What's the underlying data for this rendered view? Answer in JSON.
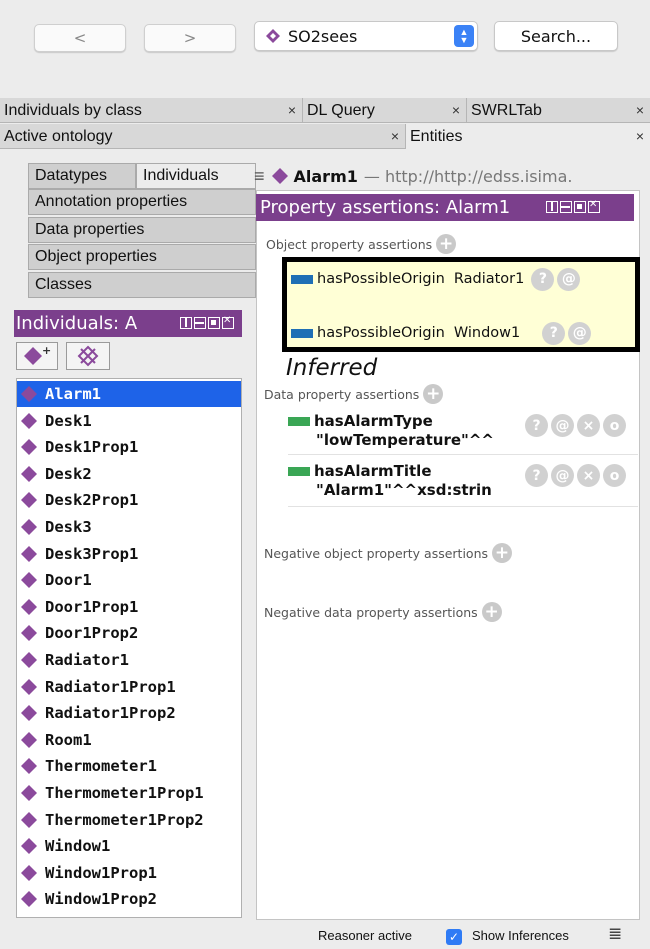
{
  "toolbar": {
    "back_label": "<",
    "forward_label": ">",
    "ontology_selector": "SO2sees",
    "search_label": "Search..."
  },
  "tabs_row1": [
    {
      "label": "Individuals by class",
      "close": "×"
    },
    {
      "label": "DL Query",
      "close": "×"
    },
    {
      "label": "SWRLTab",
      "close": "×"
    }
  ],
  "tabs_row2": [
    {
      "label": "Active ontology",
      "close": "×"
    },
    {
      "label": "Entities",
      "close": "×"
    }
  ],
  "left_tabs": {
    "datatypes": "Datatypes",
    "individuals": "Individuals",
    "annotation_properties": "Annotation properties",
    "data_properties": "Data properties",
    "object_properties": "Object properties",
    "classes": "Classes"
  },
  "individuals_panel": {
    "title": "Individuals: A",
    "items": [
      "Alarm1",
      "Desk1",
      "Desk1Prop1",
      "Desk2",
      "Desk2Prop1",
      "Desk3",
      "Desk3Prop1",
      "Door1",
      "Door1Prop1",
      "Door1Prop2",
      "Radiator1",
      "Radiator1Prop1",
      "Radiator1Prop2",
      "Room1",
      "Thermometer1",
      "Thermometer1Prop1",
      "Thermometer1Prop2",
      "Window1",
      "Window1Prop1",
      "Window1Prop2"
    ],
    "selected": "Alarm1"
  },
  "entity_header": {
    "name": "Alarm1",
    "iri": "— http://http://edss.isima."
  },
  "property_assertions": {
    "title": "Property assertions: Alarm1",
    "object_section": "Object property assertions",
    "object_assertions": [
      {
        "property": "hasPossibleOrigin",
        "value": "Radiator1"
      },
      {
        "property": "hasPossibleOrigin",
        "value": "Window1"
      }
    ],
    "inferred_label": "Inferred",
    "data_section": "Data property assertions",
    "data_assertions": [
      {
        "property": "hasAlarmType",
        "value": "\"lowTemperature\"^^"
      },
      {
        "property": "hasAlarmTitle",
        "value": "\"Alarm1\"^^xsd:strin"
      }
    ],
    "negative_object_section": "Negative object property assertions",
    "negative_data_section": "Negative data property assertions",
    "button_glyphs": {
      "help": "?",
      "annotate": "@",
      "delete": "×",
      "edit": "o",
      "add": "+"
    }
  },
  "statusbar": {
    "reasoner": "Reasoner active",
    "show_inferences": "Show Inferences",
    "show_inferences_checked": true
  },
  "colors": {
    "purple": "#7b3f8c",
    "individual_diamond": "#8b4a9c",
    "object_prop": "#1f6fb5",
    "data_prop": "#3aa655",
    "selection": "#1e63e8"
  }
}
